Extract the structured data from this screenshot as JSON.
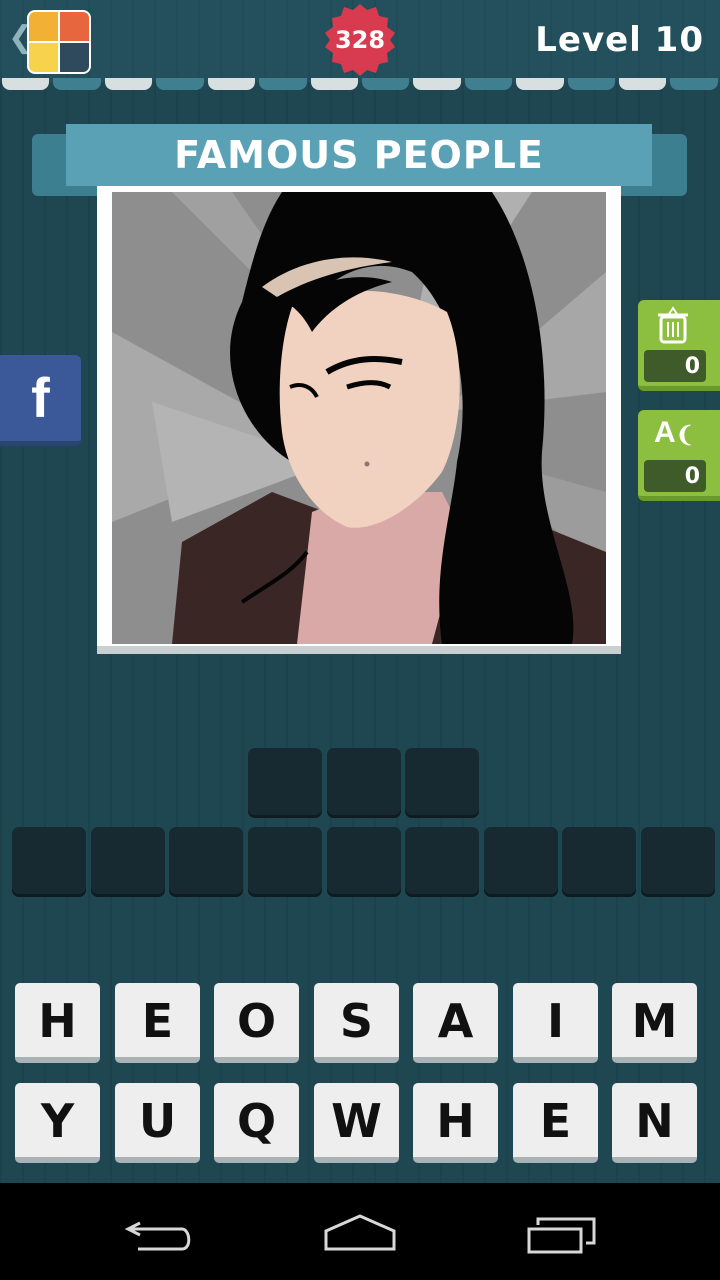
{
  "header": {
    "coins": "328",
    "level": "Level 10",
    "back_icon": "chevron-left-icon",
    "app_icon": "app-logo-icon"
  },
  "category": "FAMOUS PEOPLE",
  "hints": {
    "remove_letters_count": "0",
    "reveal_letter_count": "0",
    "reveal_letter_label": "A"
  },
  "social": {
    "facebook_label": "f"
  },
  "answer": {
    "row1_slots": 3,
    "row2_slots": 9
  },
  "letters": {
    "row1": [
      "H",
      "E",
      "O",
      "S",
      "A",
      "I",
      "M"
    ],
    "row2": [
      "Y",
      "U",
      "Q",
      "W",
      "H",
      "E",
      "N"
    ]
  },
  "colors": {
    "background": "#1f4752",
    "banner": "#5aa1b6",
    "coin_badge": "#d83b4f",
    "hint_green": "#8cbf3f",
    "facebook_blue": "#3b5998"
  }
}
